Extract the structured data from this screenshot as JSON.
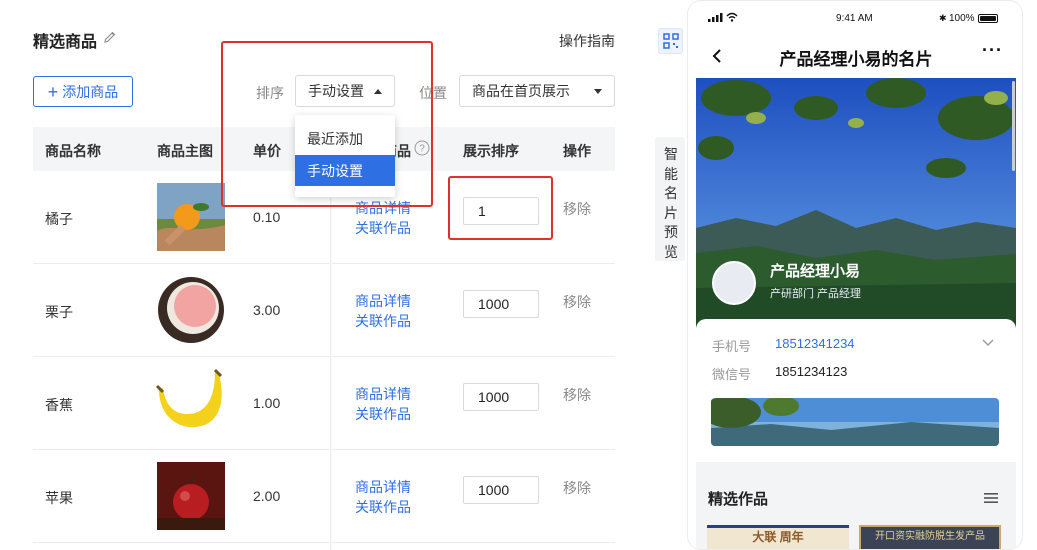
{
  "page": {
    "title": "精选商品",
    "guide": "操作指南",
    "add_button": "添加商品"
  },
  "filters": {
    "sort_label": "排序",
    "sort_value": "手动设置",
    "position_label": "位置",
    "position_value": "商品在首页展示"
  },
  "sort_dropdown": {
    "options": [
      "最近添加",
      "手动设置"
    ],
    "selected": "手动设置"
  },
  "table": {
    "headers": [
      "商品名称",
      "商品主图",
      "单价",
      "商品",
      "展示排序",
      "操作"
    ],
    "rows": [
      {
        "name": "橘子",
        "price": "0.10",
        "link1": "商品详情",
        "link2": "关联作品",
        "order": "1",
        "action": "移除"
      },
      {
        "name": "栗子",
        "price": "3.00",
        "link1": "商品详情",
        "link2": "关联作品",
        "order": "1000",
        "action": "移除"
      },
      {
        "name": "香蕉",
        "price": "1.00",
        "link1": "商品详情",
        "link2": "关联作品",
        "order": "1000",
        "action": "移除"
      },
      {
        "name": "苹果",
        "price": "2.00",
        "link1": "商品详情",
        "link2": "关联作品",
        "order": "1000",
        "action": "移除"
      }
    ]
  },
  "side_tab": {
    "label": "智能名片预览"
  },
  "phone": {
    "status": {
      "time": "9:41 AM",
      "battery": "100%"
    },
    "nav_title": "产品经理小易的名片",
    "profile": {
      "name": "产品经理小易",
      "subtitle": "产研部门 产品经理"
    },
    "contact": {
      "phone_label": "手机号",
      "phone_value": "18512341234",
      "wechat_label": "微信号",
      "wechat_value": "1851234123"
    },
    "works_title": "精选作品",
    "thumbs": [
      "大联 周年",
      "开口资实融防脱生发产品"
    ]
  },
  "colors": {
    "accent": "#2f6fe4",
    "highlight": "#e0302a"
  }
}
